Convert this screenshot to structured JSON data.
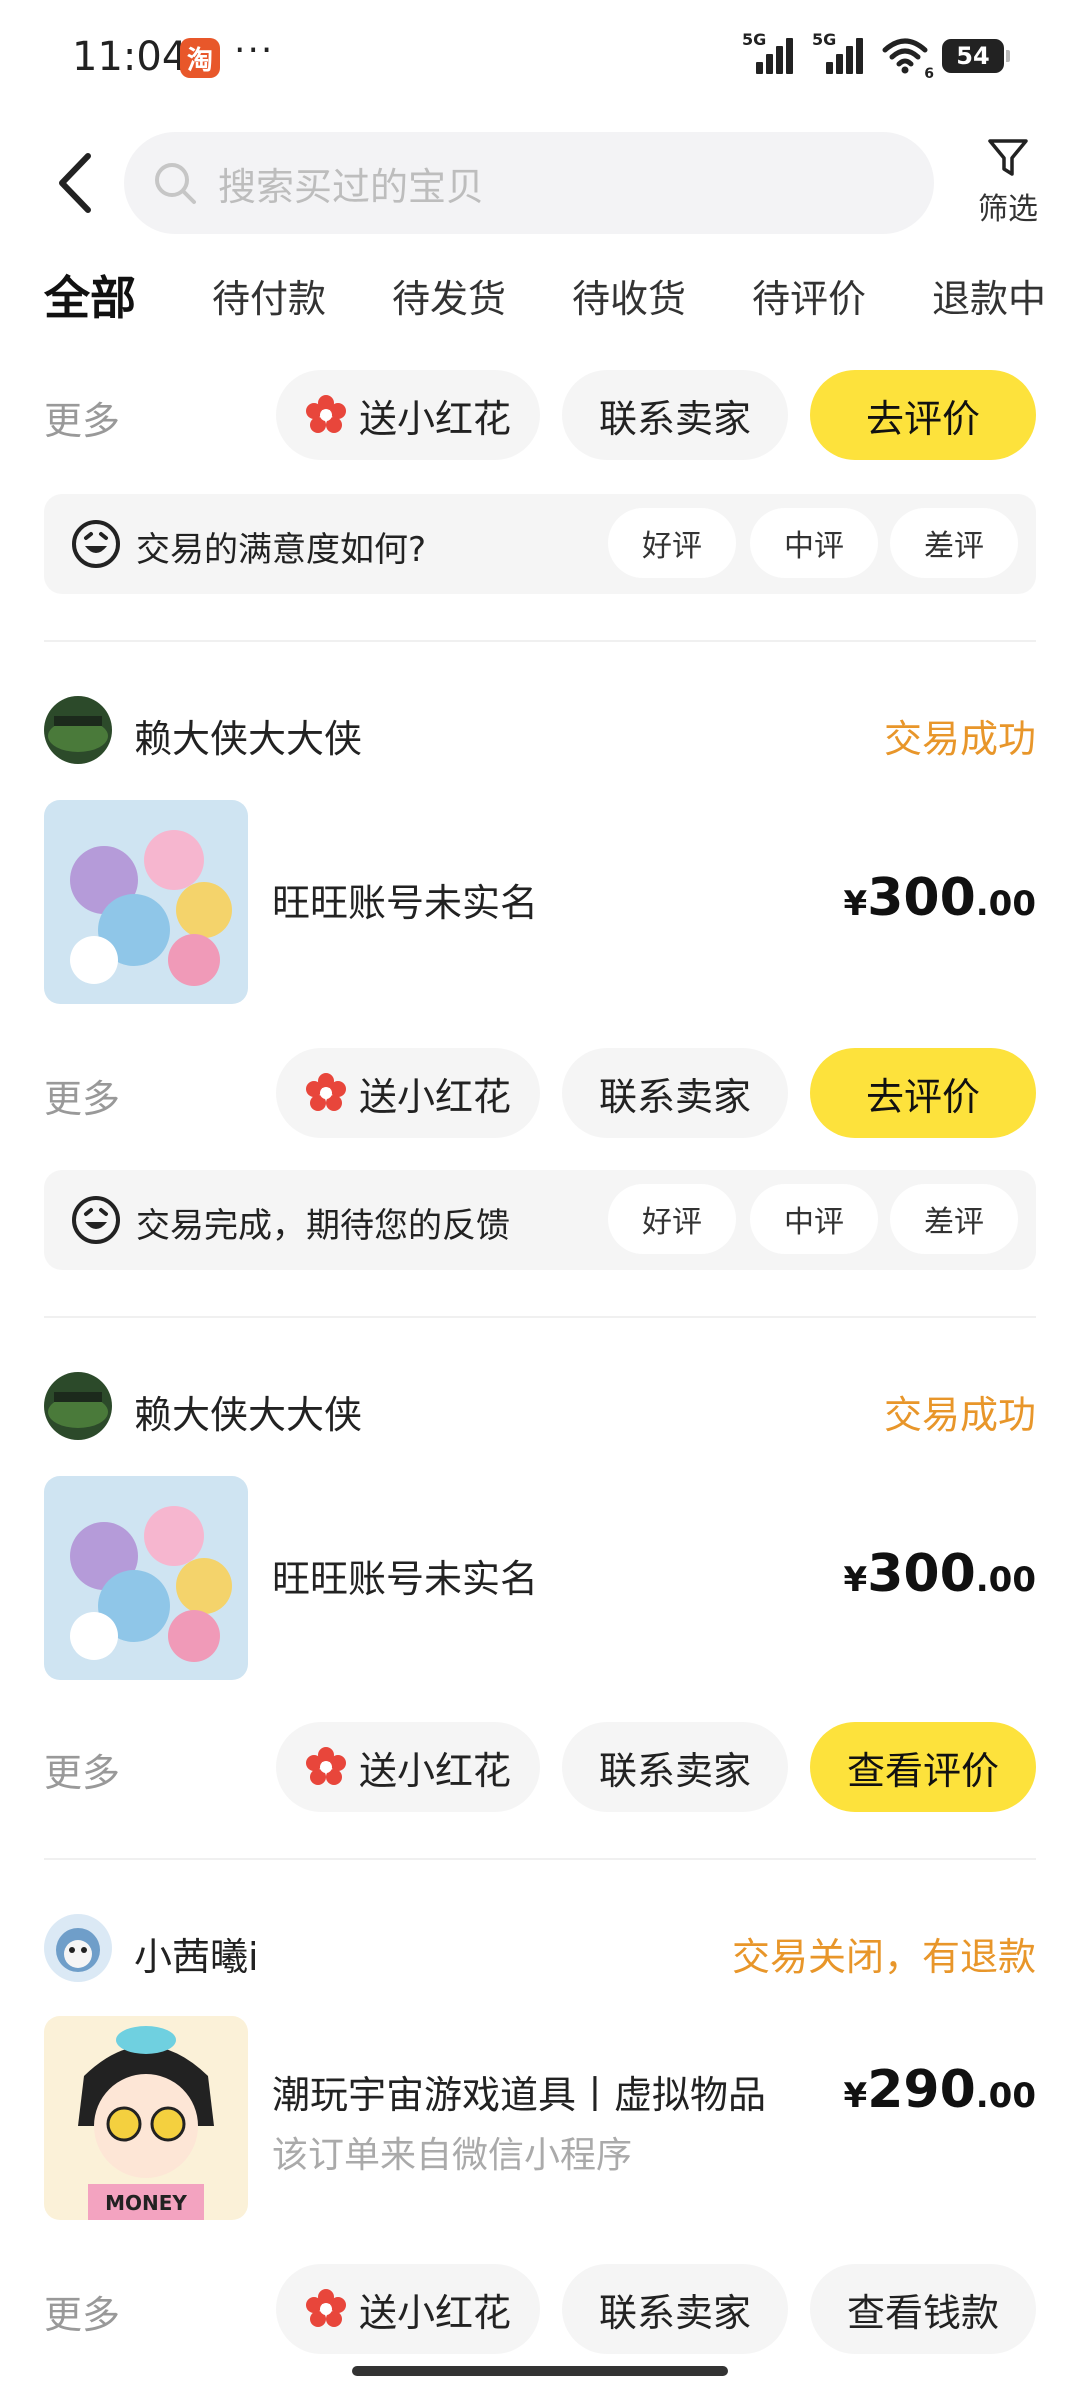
{
  "status_bar": {
    "time": "11:04",
    "app_icon_char": "淘",
    "more_dots": "···",
    "signal_1_label": "5G",
    "signal_2_label": "5G",
    "wifi_sub": "6",
    "battery": "54"
  },
  "header": {
    "search_placeholder": "搜索买过的宝贝",
    "filter_label": "筛选"
  },
  "tabs": [
    {
      "label": "全部",
      "active": true
    },
    {
      "label": "待付款"
    },
    {
      "label": "待发货"
    },
    {
      "label": "待收货"
    },
    {
      "label": "待评价"
    },
    {
      "label": "退款中"
    }
  ],
  "actions_common": {
    "more": "更多",
    "flower": "送小红花",
    "contact": "联系卖家"
  },
  "rating_labels": [
    "好评",
    "中评",
    "差评"
  ],
  "section0": {
    "main_action": "去评价",
    "satisfaction_text": "交易的满意度如何?"
  },
  "orders": [
    {
      "shop_name": "赖大侠大大侠",
      "status": "交易成功",
      "product_title": "旺旺账号未实名",
      "price_currency": "¥",
      "price_int": "300",
      "price_dec": ".00",
      "main_action": "去评价",
      "satisfaction_text": "交易完成，期待您的反馈"
    },
    {
      "shop_name": "赖大侠大大侠",
      "status": "交易成功",
      "product_title": "旺旺账号未实名",
      "price_currency": "¥",
      "price_int": "300",
      "price_dec": ".00",
      "main_action": "查看评价"
    },
    {
      "shop_name": "小茜曦i",
      "status": "交易关闭，有退款",
      "product_title": "潮玩宇宙游戏道具丨虚拟物品",
      "product_subtitle": "该订单来自微信小程序",
      "thumb_text": "MONEY",
      "price_currency": "¥",
      "price_int": "290",
      "price_dec": ".00",
      "main_action": "查看钱款"
    }
  ],
  "colors": {
    "accent_yellow": "#fde23c",
    "status_orange": "#e8962a",
    "flower_red": "#e8463b"
  }
}
